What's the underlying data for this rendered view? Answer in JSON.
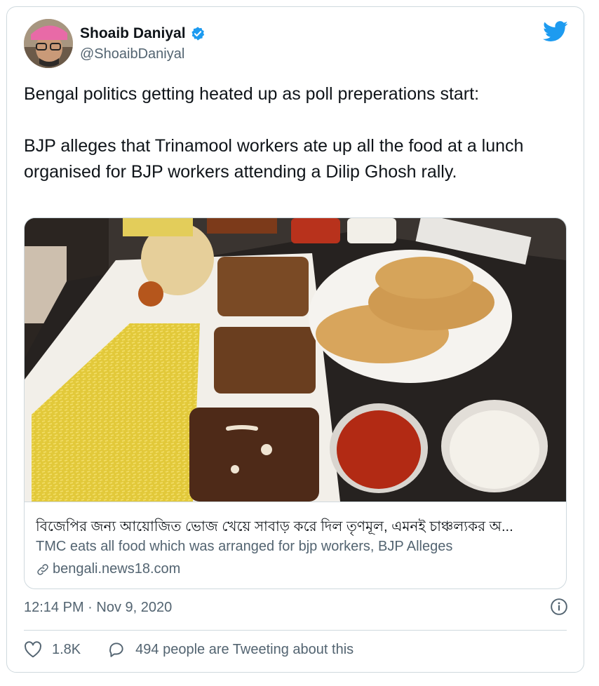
{
  "author": {
    "name": "Shoaib Daniyal",
    "handle": "@ShoaibDaniyal",
    "verified_icon": "verified-badge-icon"
  },
  "tweet": {
    "text": "Bengal politics getting heated up as poll preperations start:\n\nBJP alleges that Trinamool workers ate up all the food at a lunch organised for BJP workers attending a Dilip Ghosh rally."
  },
  "link_card": {
    "title": "বিজেপির জন্য আয়োজিত ভোজ খেয়ে সাবাড় করে দিল তৃণমূল, এমনই চাঞ্চল্যকর অ...",
    "description": "TMC eats all food which was arranged for bjp workers, BJP Alleges",
    "domain": "bengali.news18.com"
  },
  "timestamp": "12:14 PM · Nov 9, 2020",
  "actions": {
    "likes": "1.8K",
    "conversation": "494 people are Tweeting about this"
  },
  "colors": {
    "twitter_blue": "#1d9bf0",
    "secondary_text": "#536471",
    "border": "#cfd9de"
  }
}
